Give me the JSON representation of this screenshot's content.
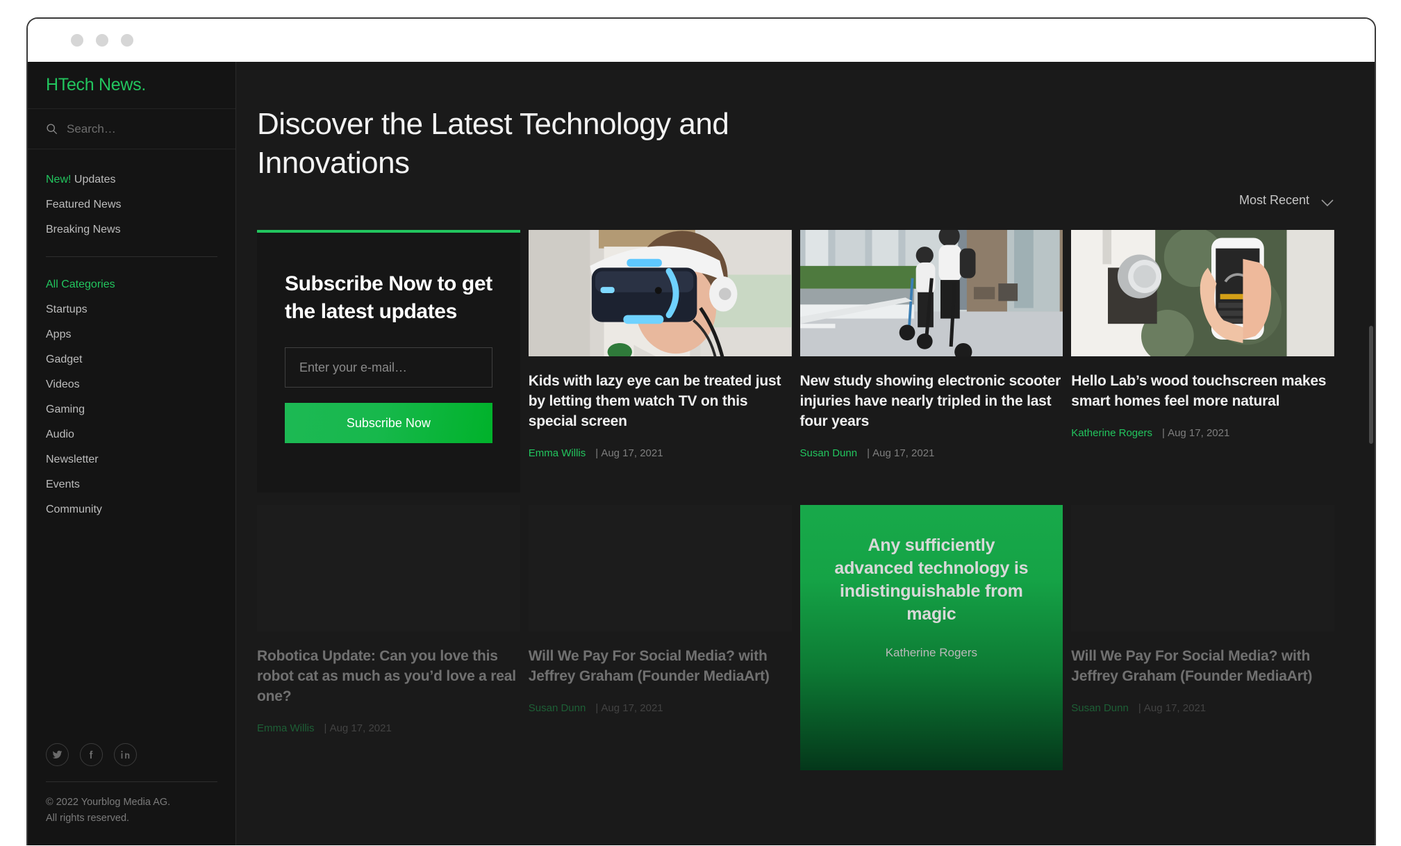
{
  "browser": {
    "dots": [
      "close",
      "minimize",
      "maximize"
    ]
  },
  "colors": {
    "accent": "#22c55e",
    "background": "#1a1a1a",
    "sidebar_bg": "#141414",
    "card_bg": "#161616"
  },
  "sidebar": {
    "brand": "HTech News.",
    "search": {
      "placeholder": "Search…",
      "value": ""
    },
    "nav": [
      {
        "tag": "New!",
        "label": " Updates"
      },
      {
        "tag": "",
        "label": "Featured News"
      },
      {
        "tag": "",
        "label": "Breaking News"
      }
    ],
    "categories": [
      {
        "label": "All Categories",
        "active": true
      },
      {
        "label": "Startups",
        "active": false
      },
      {
        "label": "Apps",
        "active": false
      },
      {
        "label": "Gadget",
        "active": false
      },
      {
        "label": "Videos",
        "active": false
      },
      {
        "label": "Gaming",
        "active": false
      },
      {
        "label": "Audio",
        "active": false
      },
      {
        "label": "Newsletter",
        "active": false
      },
      {
        "label": "Events",
        "active": false
      },
      {
        "label": "Community",
        "active": false
      }
    ],
    "socials": [
      "twitter-icon",
      "facebook-icon",
      "linkedin-icon"
    ],
    "copyright_line1": "© 2022 Yourblog Media AG.",
    "copyright_line2": "All rights reserved."
  },
  "main": {
    "title": "Discover the Latest Technology and Innovations",
    "sort": {
      "label": "Most Recent",
      "icon": "chevron-down-icon"
    }
  },
  "subscribe": {
    "title": "Subscribe Now to get the latest updates",
    "email_placeholder": "Enter your e-mail…",
    "email_value": "",
    "button_label": "Subscribe Now"
  },
  "articles_row1": [
    {
      "title": "Kids with lazy eye can be treated just by letting them watch TV on this special screen",
      "author": "Emma Willis",
      "date": "Aug 17, 2021",
      "image": "vr-headset-photo"
    },
    {
      "title": "New study showing electronic scooter injuries have nearly tripled in the last four years",
      "author": "Susan Dunn",
      "date": "Aug 17, 2021",
      "image": "electric-scooter-riders-photo"
    },
    {
      "title": "Hello Lab’s wood touchscreen makes smart homes feel more natural",
      "author": "Katherine Rogers",
      "date": "Aug 17, 2021",
      "image": "smart-lock-phone-photo"
    }
  ],
  "articles_row2": [
    {
      "title": "Robotica Update: Can you love this robot cat as much as you’d love a real one?",
      "author": "Emma Willis",
      "date": "Aug 17, 2021",
      "image": "placeholder"
    },
    {
      "title": "Will We Pay For Social Media? with Jeffrey Graham (Founder MediaArt)",
      "author": "Susan Dunn",
      "date": "Aug 17, 2021",
      "image": "placeholder"
    },
    {
      "title": "Will We Pay For Social Media? with Jeffrey Graham (Founder MediaArt)",
      "author": "Susan Dunn",
      "date": "Aug 17, 2021",
      "image": "placeholder"
    }
  ],
  "quote_card": {
    "quote": "Any sufficiently advanced technology is indistinguishable from magic",
    "author": "Katherine Rogers"
  }
}
